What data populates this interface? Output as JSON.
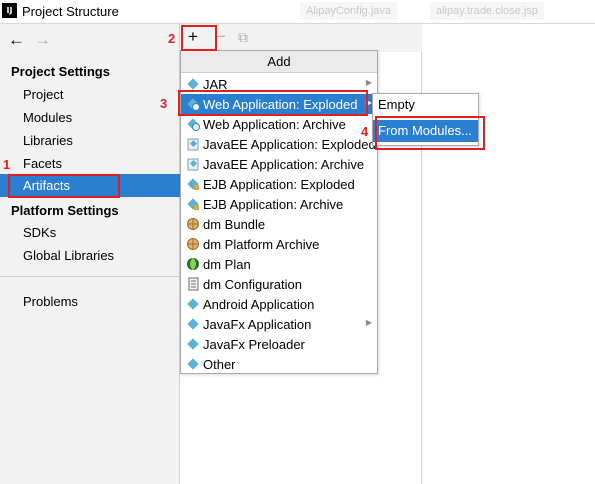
{
  "window": {
    "title": "Project Structure",
    "app_icon": "IJ",
    "background_tabs": [
      "AlipayConfig.java",
      "alipay.trade.close.jsp"
    ]
  },
  "nav": {
    "back_icon": "←",
    "forward_icon": "→"
  },
  "sidebar": {
    "project_settings_title": "Project Settings",
    "project_items": [
      "Project",
      "Modules",
      "Libraries",
      "Facets",
      "Artifacts"
    ],
    "selected_item": "Artifacts",
    "platform_settings_title": "Platform Settings",
    "platform_items": [
      "SDKs",
      "Global Libraries"
    ],
    "other_items": [
      "Problems"
    ]
  },
  "toolbar": {
    "add_icon": "+",
    "remove_icon": "−",
    "copy_icon": "⧉"
  },
  "add_menu": {
    "header": "Add",
    "items": [
      {
        "label": "JAR",
        "icon": "diamond-icon",
        "submenu": true
      },
      {
        "label": "Web Application: Exploded",
        "icon": "web-icon",
        "submenu": true,
        "selected": true
      },
      {
        "label": "Web Application: Archive",
        "icon": "web-icon"
      },
      {
        "label": "JavaEE Application: Exploded",
        "icon": "javaee-icon"
      },
      {
        "label": "JavaEE Application: Archive",
        "icon": "javaee-icon"
      },
      {
        "label": "EJB Application: Exploded",
        "icon": "ejb-icon"
      },
      {
        "label": "EJB Application: Archive",
        "icon": "ejb-icon"
      },
      {
        "label": "dm Bundle",
        "icon": "dm-bundle-icon"
      },
      {
        "label": "dm Platform Archive",
        "icon": "dm-bundle-icon"
      },
      {
        "label": "dm Plan",
        "icon": "dm-plan-icon"
      },
      {
        "label": "dm Configuration",
        "icon": "document-icon"
      },
      {
        "label": "Android Application",
        "icon": "diamond-icon"
      },
      {
        "label": "JavaFx Application",
        "icon": "diamond-icon",
        "submenu": true
      },
      {
        "label": "JavaFx Preloader",
        "icon": "diamond-icon"
      },
      {
        "label": "Other",
        "icon": "diamond-icon"
      }
    ]
  },
  "sub_menu": {
    "items": [
      "Empty",
      "From Modules..."
    ]
  },
  "annotations": [
    "1",
    "2",
    "3",
    "4"
  ],
  "colors": {
    "selection": "#2a7fd1",
    "annotation": "#e02020"
  }
}
